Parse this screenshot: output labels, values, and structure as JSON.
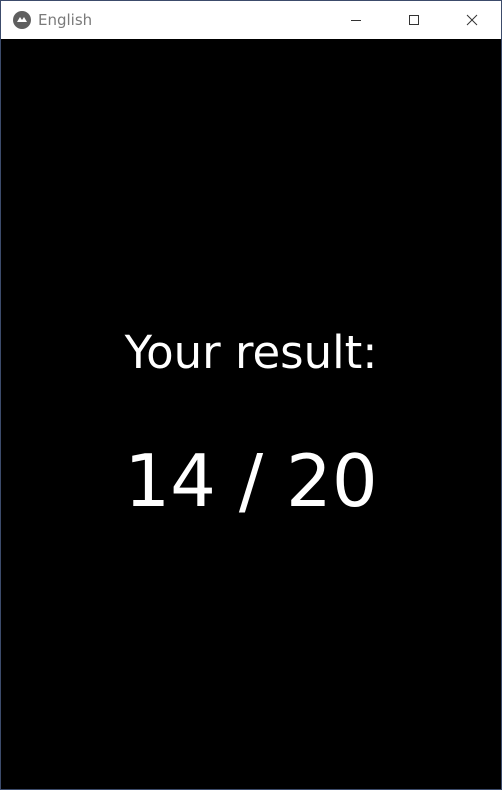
{
  "window": {
    "title": "English",
    "icon": "kivy-app-icon",
    "controls": [
      "minimize-icon",
      "maximize-icon",
      "close-icon"
    ]
  },
  "result": {
    "label": "Your result:",
    "score_text": "14 / 20",
    "score": 14,
    "total": 20
  },
  "colors": {
    "background": "#000000",
    "text": "#ffffff",
    "titlebar": "#ffffff"
  }
}
